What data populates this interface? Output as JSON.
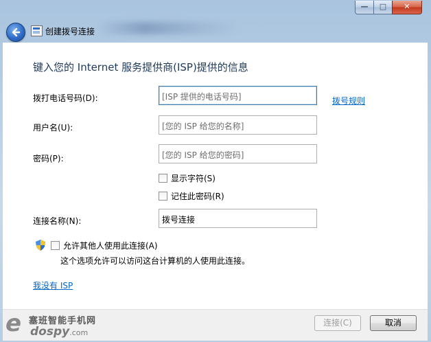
{
  "window": {
    "title": "创建拨号连接",
    "minimize_label": "—",
    "maximize_label": "□",
    "close_label": "✕"
  },
  "main": {
    "heading": "键入您的 Internet 服务提供商(ISP)提供的信息",
    "phone_label": "拨打电话号码(D):",
    "phone_placeholder": "[ISP 提供的电话号码]",
    "dialing_rules_link": "拨号规则",
    "username_label": "用户名(U):",
    "username_placeholder": "[您的 ISP 给您的名称]",
    "password_label": "密码(P):",
    "password_placeholder": "[您的 ISP 给您的密码]",
    "show_chars_label": "显示字符(S)",
    "remember_password_label": "记住此密码(R)",
    "connection_name_label": "连接名称(N):",
    "connection_name_value": "拨号连接",
    "allow_others_label": "允许其他人使用此连接(A)",
    "allow_others_desc": "这个选项允许可以访问这台计算机的人使用此连接。",
    "no_isp_link": "我没有 ISP"
  },
  "footer": {
    "connect_label": "连接(C)",
    "cancel_label": "取消"
  },
  "watermark": {
    "brand_cn": "塞班智能手机网",
    "brand_letter": "e",
    "brand_domain": "dospy",
    "brand_tld": ".com"
  },
  "colors": {
    "heading": "#1e395b",
    "link": "#0066cc",
    "frame": "#b7cde2"
  }
}
